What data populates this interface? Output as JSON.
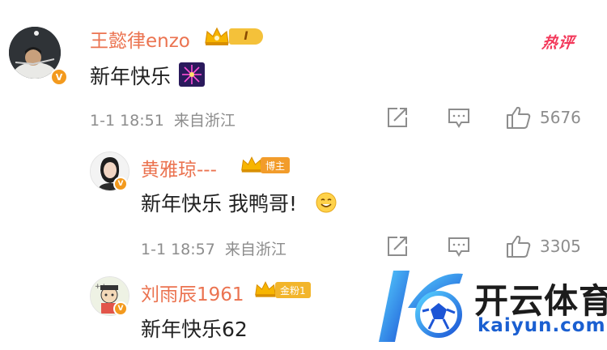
{
  "hot_label": "热评",
  "main_comment": {
    "username": "王懿律enzo",
    "badge_text": "I",
    "verified_mark": "V",
    "text": "新年快乐",
    "emoji": "fireworks",
    "time": "1-1 18:51",
    "location": "来自浙江",
    "likes": "5676"
  },
  "replies": [
    {
      "username": "黄雅琼---",
      "badge_text": "博主",
      "verified_mark": "V",
      "text": "新年快乐 我鸭哥!",
      "emoji": "smile",
      "time": "1-1 18:57",
      "location": "来自浙江",
      "likes": "3305"
    },
    {
      "username": "刘雨辰1961",
      "badge_text": "金粉1",
      "verified_mark": "V",
      "text": "新年快乐62"
    }
  ],
  "watermark": {
    "name_cn": "开云体育",
    "name_en": "kaiyun.com"
  },
  "colors": {
    "username": "#eb7350",
    "meta": "#8d8d8d",
    "hot": "#f3385a",
    "verified": "#f39a1e",
    "brand_blue": "#1a5fd1"
  }
}
